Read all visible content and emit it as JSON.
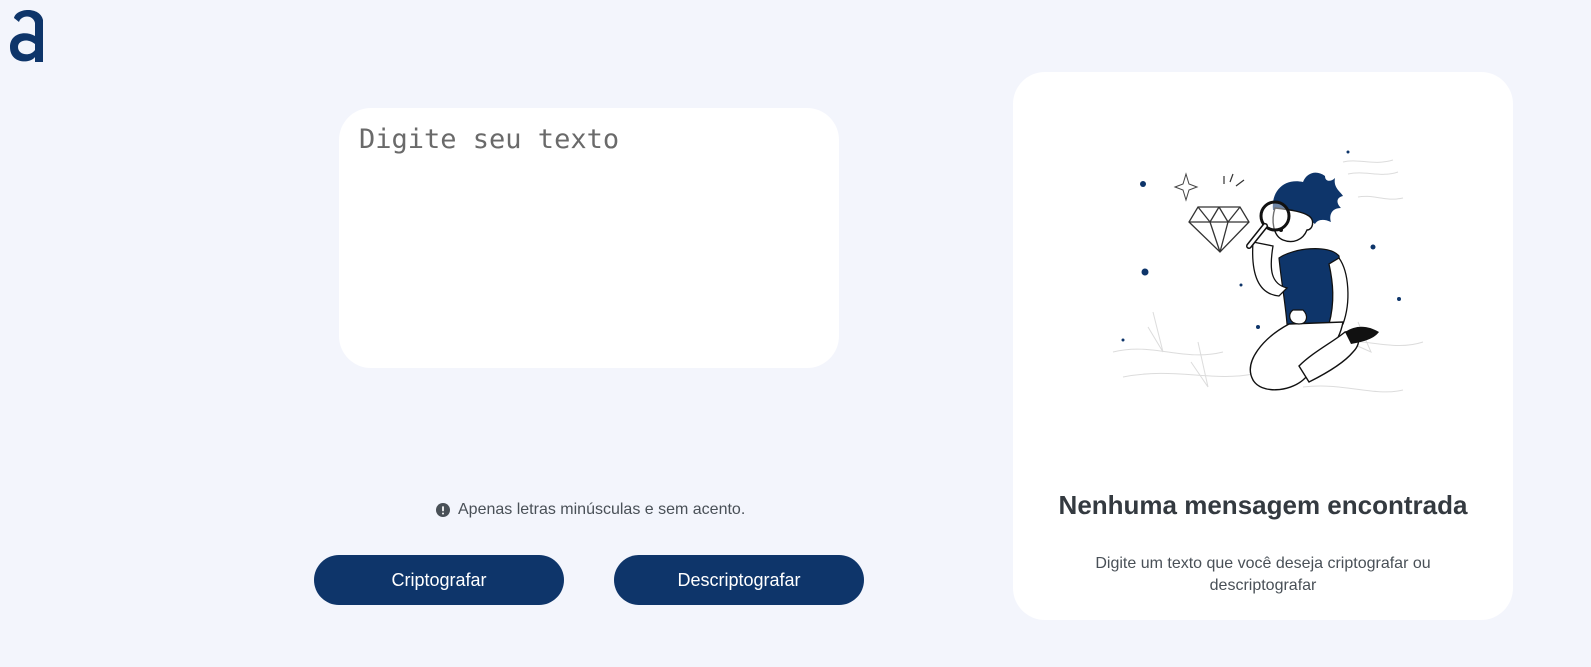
{
  "brand": {
    "logo_letter": "a",
    "accent_color": "#0e356a"
  },
  "input": {
    "placeholder": "Digite seu texto",
    "value": ""
  },
  "hint": {
    "icon": "exclamation-circle-icon",
    "text": "Apenas letras minúsculas e sem acento."
  },
  "buttons": {
    "encrypt_label": "Criptografar",
    "decrypt_label": "Descriptografar"
  },
  "output": {
    "illustration": "person-with-magnifying-glass-and-diamond",
    "title": "Nenhuma mensagem encontrada",
    "subtitle": "Digite um texto que você deseja criptografar ou descriptografar"
  }
}
